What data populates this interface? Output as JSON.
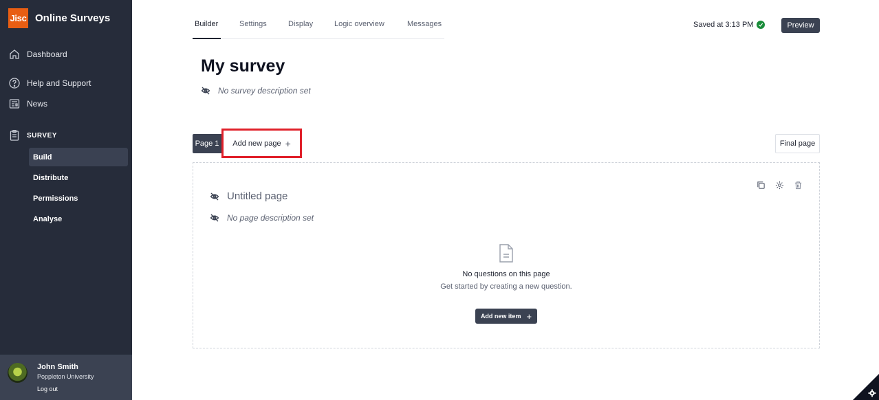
{
  "app": {
    "logo_text": "Jisc",
    "brand_name": "Online Surveys"
  },
  "sidebar": {
    "nav": [
      {
        "label": "Dashboard",
        "icon": "home-icon"
      },
      {
        "label": "Help and Support",
        "icon": "help-icon"
      },
      {
        "label": "News",
        "icon": "news-icon"
      }
    ],
    "section_label": "SURVEY",
    "section_icon": "clipboard-icon",
    "sub_items": [
      {
        "label": "Build",
        "active": true
      },
      {
        "label": "Distribute"
      },
      {
        "label": "Permissions"
      },
      {
        "label": "Analyse"
      }
    ],
    "user": {
      "name": "John Smith",
      "org": "Poppleton University",
      "logout": "Log out"
    }
  },
  "tabs": [
    "Builder",
    "Settings",
    "Display",
    "Logic overview",
    "Messages"
  ],
  "header": {
    "saved_text": "Saved at 3:13 PM",
    "preview_label": "Preview"
  },
  "survey": {
    "title": "My survey",
    "description_placeholder": "No survey description set"
  },
  "pages": {
    "current_tab": "Page 1",
    "add_page_label": "Add new page",
    "final_page_label": "Final page"
  },
  "page_card": {
    "title": "Untitled page",
    "description_placeholder": "No page description set",
    "empty_title": "No questions on this page",
    "empty_subtitle": "Get started by creating a new question.",
    "add_item_label": "Add new item"
  },
  "colors": {
    "sidebar_bg": "#262c3a",
    "accent_dark": "#3b4252",
    "logo_orange": "#e85e13",
    "saved_green": "#1a8c3a",
    "highlight_red": "#e0202a"
  }
}
